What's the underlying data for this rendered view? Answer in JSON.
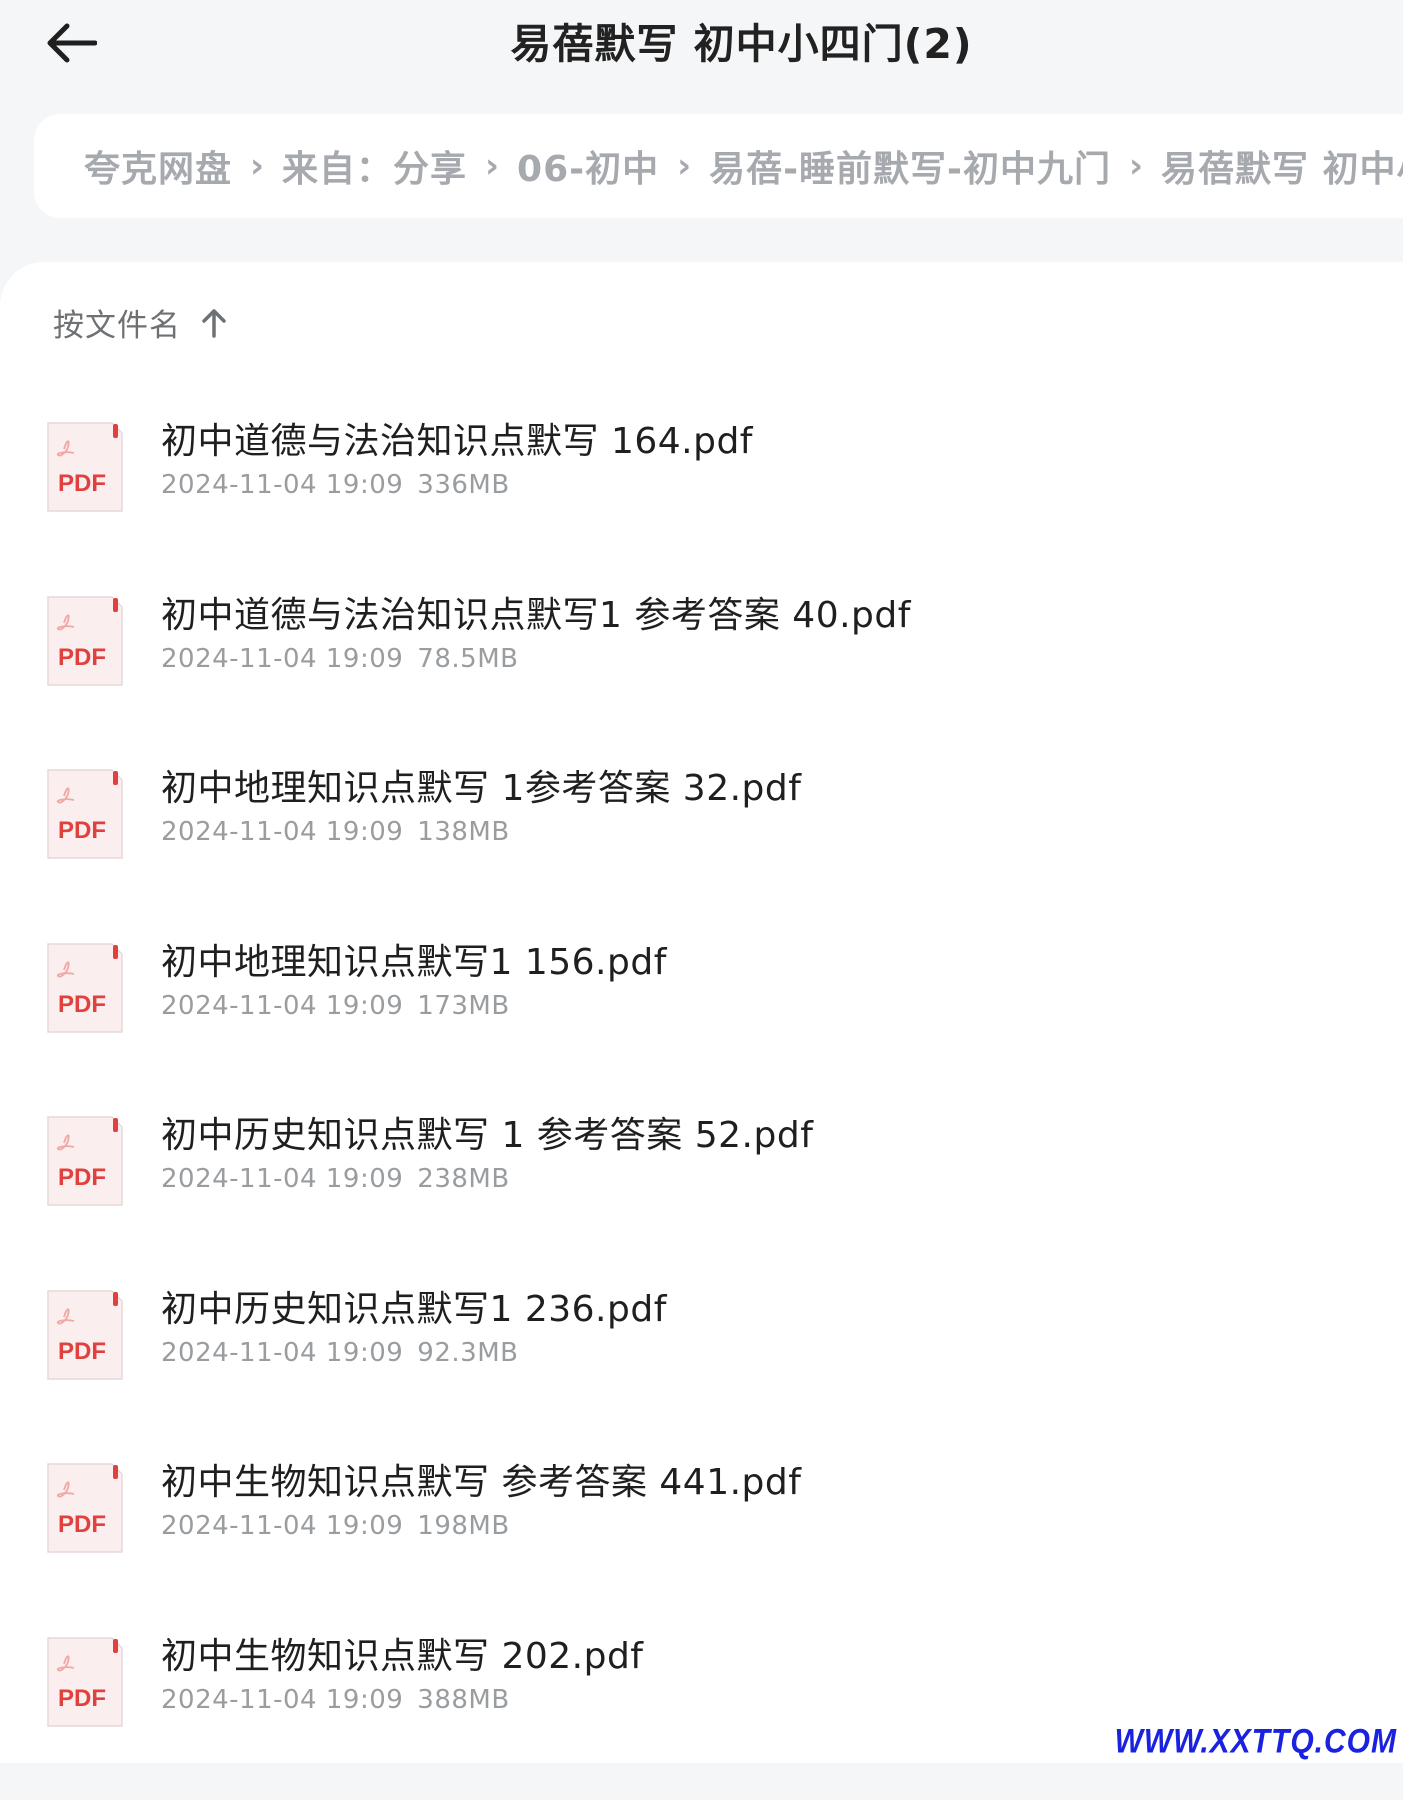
{
  "header": {
    "title": "易蓓默写 初中小四门(2)"
  },
  "breadcrumb": [
    "夸克网盘",
    "来自：分享",
    "06-初中",
    "易蓓-睡前默写-初中九门",
    "易蓓默写 初中小"
  ],
  "sort": {
    "label": "按文件名",
    "direction": "ascending"
  },
  "files": [
    {
      "name": "初中道德与法治知识点默写 164.pdf",
      "date": "2024-11-04 19:09",
      "size": "336MB",
      "icon_label": "PDF"
    },
    {
      "name": "初中道德与法治知识点默写1 参考答案 40.pdf",
      "date": "2024-11-04 19:09",
      "size": "78.5MB",
      "icon_label": "PDF"
    },
    {
      "name": "初中地理知识点默写 1参考答案 32.pdf",
      "date": "2024-11-04 19:09",
      "size": "138MB",
      "icon_label": "PDF"
    },
    {
      "name": "初中地理知识点默写1 156.pdf",
      "date": "2024-11-04 19:09",
      "size": "173MB",
      "icon_label": "PDF"
    },
    {
      "name": "初中历史知识点默写 1 参考答案 52.pdf",
      "date": "2024-11-04 19:09",
      "size": "238MB",
      "icon_label": "PDF"
    },
    {
      "name": "初中历史知识点默写1 236.pdf",
      "date": "2024-11-04 19:09",
      "size": "92.3MB",
      "icon_label": "PDF"
    },
    {
      "name": "初中生物知识点默写  参考答案 441.pdf",
      "date": "2024-11-04 19:09",
      "size": "198MB",
      "icon_label": "PDF"
    },
    {
      "name": "初中生物知识点默写 202.pdf",
      "date": "2024-11-04 19:09",
      "size": "388MB",
      "icon_label": "PDF"
    }
  ],
  "watermark": "WWW.XXTTQ.COM",
  "colors": {
    "pdf_red": "#e0413f",
    "pdf_bg": "#fbeeee",
    "text_primary": "#1f1f1f",
    "text_secondary": "#9a9da0",
    "breadcrumb_text": "#a6a9ad",
    "watermark": "#1a22e0"
  }
}
